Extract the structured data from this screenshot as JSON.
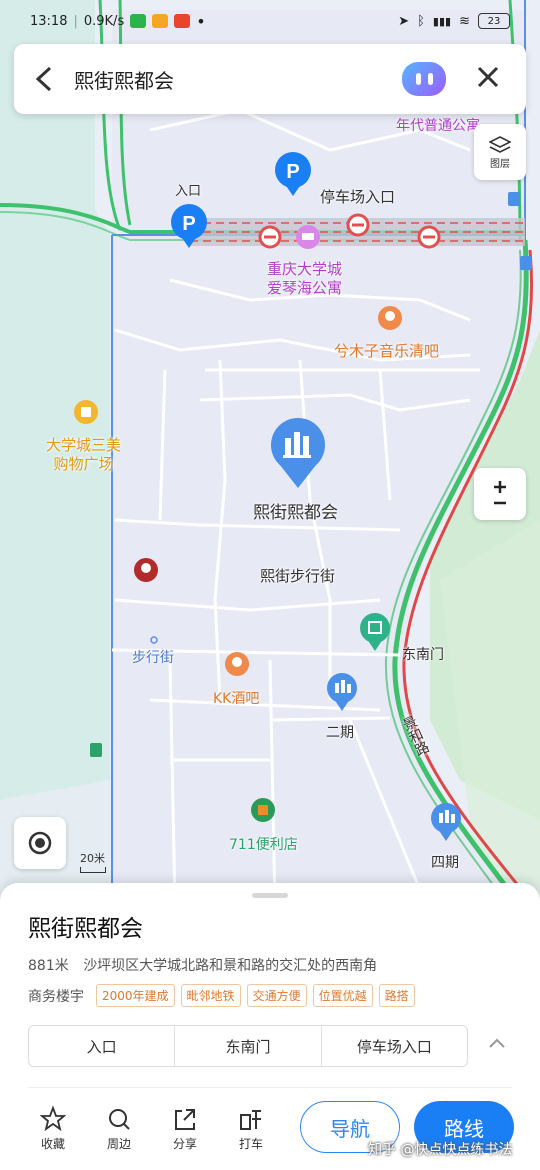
{
  "status_bar": {
    "time": "13:18",
    "speed": "0.9K/s",
    "battery": "23"
  },
  "search": {
    "query": "熙街熙都会"
  },
  "map_controls": {
    "layers_label": "图层",
    "zoom_symbol": "+\n−",
    "scale": "20米"
  },
  "map_labels": {
    "entrance": "入口",
    "parking_entrance": "停车场入口",
    "top_poi": "年代普通公寓",
    "hotel": "重庆大学城\n爱琴海公寓",
    "music_bar": "兮木子音乐清吧",
    "mall": "大学城三美\n购物广场",
    "main_poi": "熙街熙都会",
    "pedestrian_street": "熙街步行街",
    "walk_street": "步行街",
    "southeast_gate": "东南门",
    "kk_bar": "KK酒吧",
    "phase2": "二期",
    "road": "景和路",
    "seven_eleven": "711便利店",
    "phase4": "四期"
  },
  "place": {
    "name": "熙街熙都会",
    "distance": "881米",
    "address": "沙坪坝区大学城北路和景和路的交汇处的西南角",
    "category": "商务楼宇",
    "tags": [
      "2000年建成",
      "毗邻地铁",
      "交通方便",
      "位置优越",
      "路搭"
    ],
    "entries": [
      "入口",
      "东南门",
      "停车场入口"
    ]
  },
  "actions": [
    {
      "label": "收藏",
      "icon": "star-icon"
    },
    {
      "label": "周边",
      "icon": "search-icon"
    },
    {
      "label": "分享",
      "icon": "share-icon"
    },
    {
      "label": "打车",
      "icon": "taxi-icon"
    }
  ],
  "buttons": {
    "navigate": "导航",
    "route": "路线"
  },
  "watermark": "知乎 @快点快点练书法",
  "colors": {
    "accent": "#1a7ff5",
    "poi_orange": "#e07a2c",
    "map_bg": "#eaeef6",
    "water": "#d5ece9",
    "park": "#d4ecd6"
  }
}
